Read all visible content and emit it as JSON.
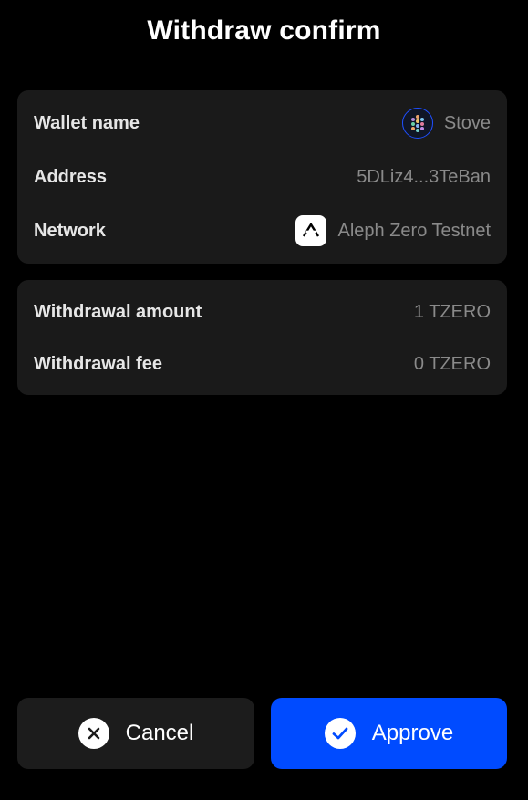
{
  "header": {
    "title": "Withdraw confirm"
  },
  "details": {
    "wallet_label": "Wallet name",
    "wallet_value": "Stove",
    "address_label": "Address",
    "address_value": "5DLiz4...3TeBan",
    "network_label": "Network",
    "network_value": "Aleph Zero Testnet"
  },
  "amounts": {
    "amount_label": "Withdrawal amount",
    "amount_value": "1 TZERO",
    "fee_label": "Withdrawal fee",
    "fee_value": "0 TZERO"
  },
  "actions": {
    "cancel_label": "Cancel",
    "approve_label": "Approve"
  },
  "icons": {
    "wallet": "wallet-avatar-icon",
    "network": "aleph-zero-logo-icon",
    "cancel": "close-icon",
    "approve": "checkmark-icon"
  },
  "colors": {
    "background": "#000000",
    "card": "#1a1a1a",
    "approve": "#004bff",
    "cancel": "#1c1c1c",
    "muted_text": "#8a8a8a"
  }
}
